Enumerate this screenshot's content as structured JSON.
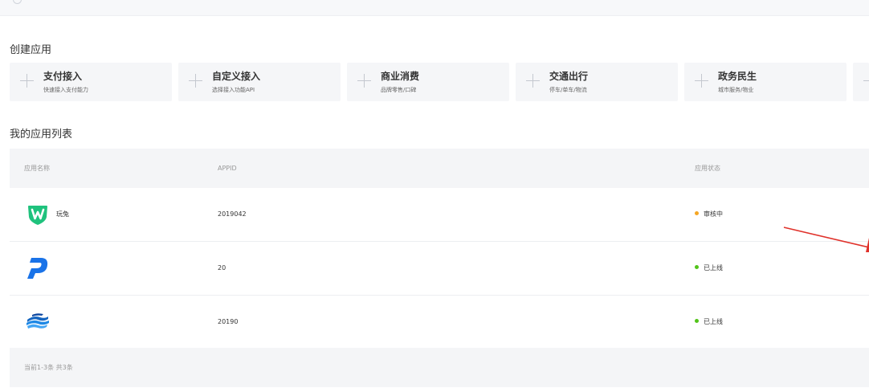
{
  "create_section": {
    "title": "创建应用",
    "cards": [
      {
        "title": "支付接入",
        "subtitle": "快速接入支付能力"
      },
      {
        "title": "自定义接入",
        "subtitle": "选择接入功能API"
      },
      {
        "title": "商业消费",
        "subtitle": "品牌零售/口碑"
      },
      {
        "title": "交通出行",
        "subtitle": "停车/单车/物流"
      },
      {
        "title": "政务民生",
        "subtitle": "城市服务/物业"
      }
    ]
  },
  "app_list": {
    "title": "我的应用列表",
    "columns": {
      "name": "应用名称",
      "appid": "APPID",
      "status": "应用状态"
    },
    "rows": [
      {
        "name": "玩兔",
        "appid": "2019042",
        "status": "审核中",
        "status_color": "#f5a623",
        "icon": "wantu-logo-icon"
      },
      {
        "name": "",
        "appid": "20",
        "status": "已上线",
        "status_color": "#52c41a",
        "icon": "blue-d-logo-icon"
      },
      {
        "name": "",
        "appid": "20190",
        "status": "已上线",
        "status_color": "#52c41a",
        "icon": "blue-wave-logo-icon"
      }
    ],
    "pagination": "当前1-3条 共3条"
  },
  "colors": {
    "card_bg": "#f5f6f8",
    "header_bg": "#f4f5f7",
    "arrow": "#e0322b",
    "brand_green": "#1fc27d",
    "brand_blue": "#1a73e8"
  }
}
